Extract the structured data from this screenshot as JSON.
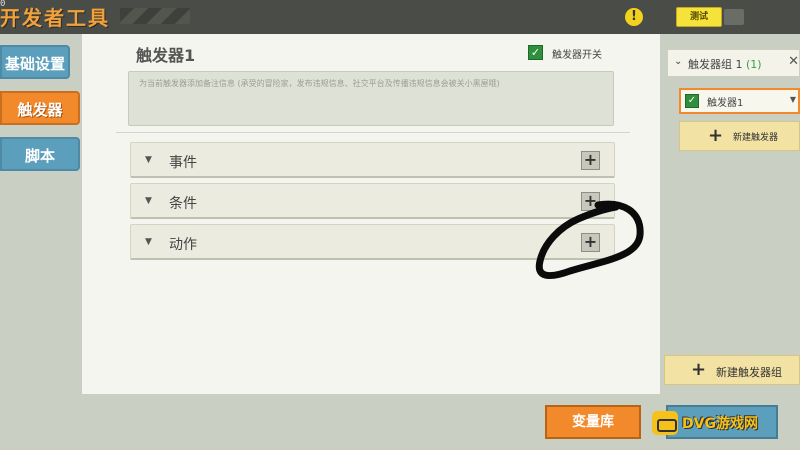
{
  "header": {
    "app_title": "开发者工具",
    "corner_digit": "0",
    "warning_icon": "exclamation-icon",
    "test_button_label": "测试"
  },
  "sidebar": {
    "items": [
      {
        "label": "基础设置",
        "active": false
      },
      {
        "label": "触发器",
        "active": true
      },
      {
        "label": "脚本",
        "active": false
      }
    ]
  },
  "main": {
    "trigger_title": "触发器1",
    "switch_label": "触发器开关",
    "switch_checked": true,
    "note_placeholder": "为当前触发器添加备注信息 (承受的冒险家，发布违规信息、社交平台及传播违规信息会被关小黑屋哦)",
    "sections": [
      {
        "label": "事件"
      },
      {
        "label": "条件"
      },
      {
        "label": "动作"
      }
    ]
  },
  "right_panel": {
    "group_label": "触发器组 1",
    "group_count": "(1)",
    "item_label": "触发器1",
    "item_checked": true,
    "new_trigger_label": "新建触发器",
    "new_group_label": "新建触发器组"
  },
  "footer": {
    "variables_button_label": "变量库",
    "watermark_text": "DVG游戏网"
  },
  "colors": {
    "accent_orange": "#f28a2b",
    "nav_blue": "#5b9fbc",
    "check_green": "#2f8f3c",
    "title_orange": "#f3a23a"
  }
}
